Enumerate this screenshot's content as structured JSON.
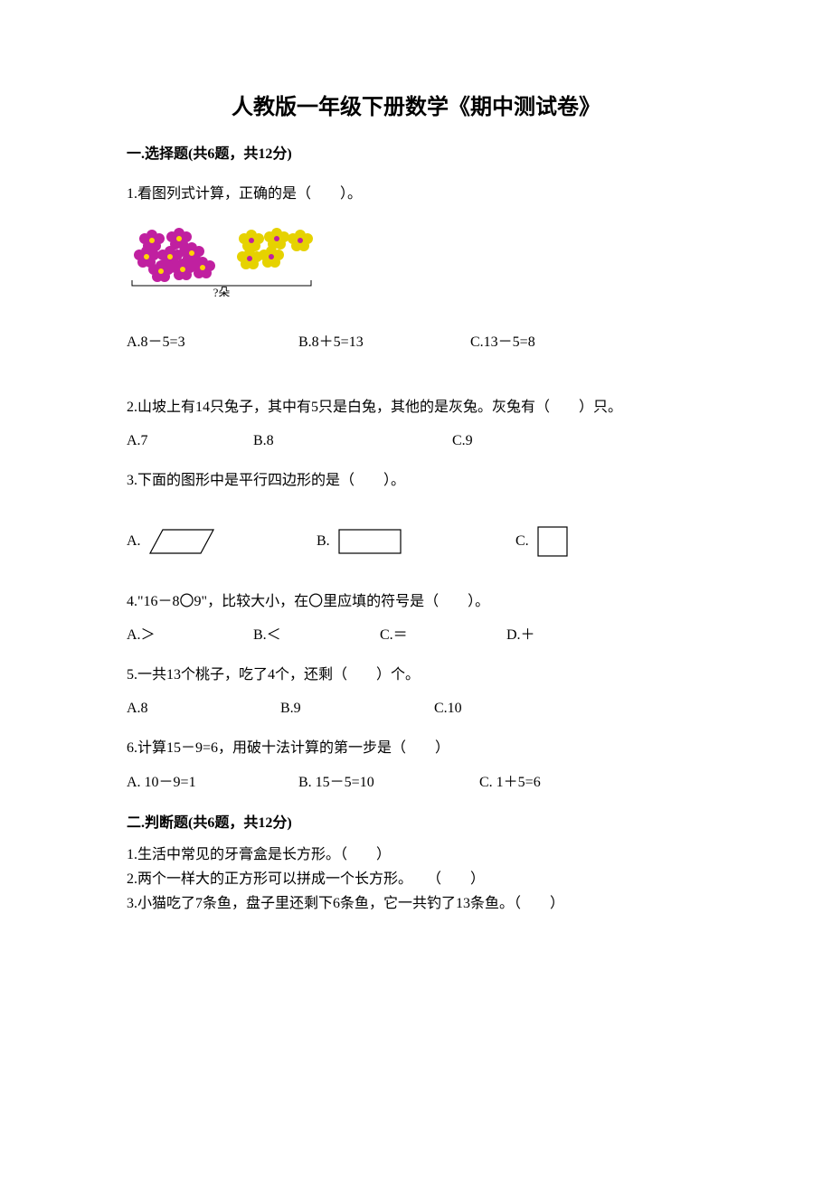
{
  "title": "人教版一年级下册数学《期中测试卷》",
  "sections": {
    "s1": {
      "header": "一.选择题(共6题，共12分)"
    },
    "s2": {
      "header": "二.判断题(共6题，共12分)"
    }
  },
  "questions": {
    "q1": {
      "text": "1.看图列式计算，正确的是（　　）。",
      "img_caption": "?朵",
      "opts": {
        "a": "A.8－5=3",
        "b": "B.8＋5=13",
        "c": "C.13－5=8"
      }
    },
    "q2": {
      "text": "2.山坡上有14只兔子，其中有5只是白兔，其他的是灰兔。灰兔有（　　）只。",
      "opts": {
        "a": "A.7",
        "b": "B.8",
        "c": "C.9"
      }
    },
    "q3": {
      "text": "3.下面的图形中是平行四边形的是（　　）。",
      "opts": {
        "a": "A.",
        "b": "B.",
        "c": "C."
      }
    },
    "q4": {
      "text": "4.\"16－8〇9\"，比较大小，在〇里应填的符号是（　　）。",
      "opts": {
        "a": "A.＞",
        "b": "B.＜",
        "c": "C.＝",
        "d": "D.＋"
      }
    },
    "q5": {
      "text": "5.一共13个桃子，吃了4个，还剩（　　）个。",
      "opts": {
        "a": "A.8",
        "b": "B.9",
        "c": "C.10"
      }
    },
    "q6": {
      "text": "6.计算15－9=6，用破十法计算的第一步是（　　）",
      "opts": {
        "a": "A. 10－9=1",
        "b": "B. 15－5=10",
        "c": "C. 1＋5=6"
      }
    },
    "tf1": {
      "text": "1.生活中常见的牙膏盒是长方形。（　　）"
    },
    "tf2": {
      "text": "2.两个一样大的正方形可以拼成一个长方形。　　（　　）"
    },
    "tf3": {
      "text": "3.小猫吃了7条鱼，盘子里还剩下6条鱼，它一共钓了13条鱼。（　　）"
    }
  }
}
